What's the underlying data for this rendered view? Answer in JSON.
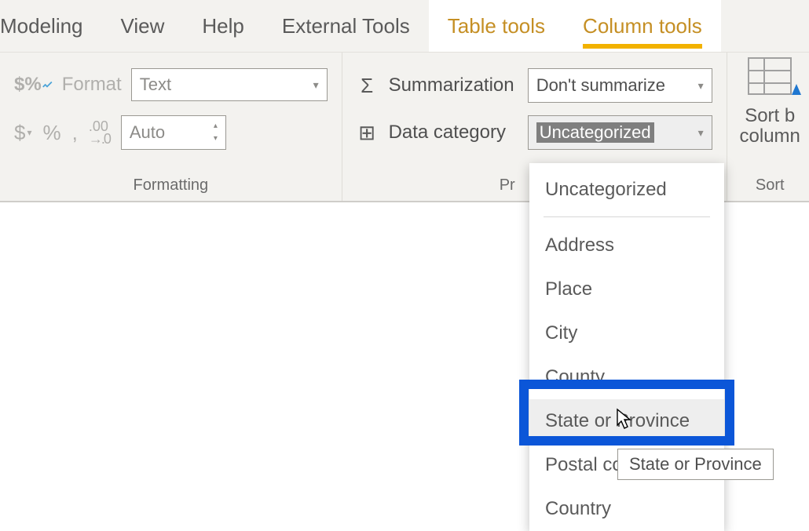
{
  "tabs": {
    "modeling": "Modeling",
    "view": "View",
    "help": "Help",
    "external_tools": "External Tools",
    "table_tools": "Table tools",
    "column_tools": "Column tools"
  },
  "formatting": {
    "format_label": "Format",
    "format_value": "Text",
    "auto_value": "Auto",
    "group_label": "Formatting"
  },
  "properties": {
    "summarization_label": "Summarization",
    "summarization_value": "Don't summarize",
    "data_category_label": "Data category",
    "data_category_value": "Uncategorized",
    "group_label_truncated": "Pr"
  },
  "sort": {
    "line1": "Sort b",
    "line2": "column",
    "group_label_truncated": "Sort"
  },
  "data_category_dropdown": {
    "items": [
      "Uncategorized",
      "Address",
      "Place",
      "City",
      "County",
      "State or Province",
      "Postal code",
      "Country"
    ],
    "hover_index": 5,
    "tooltip": "State or Province"
  },
  "icons": {
    "format": "$%",
    "currency": "$",
    "percent": "%",
    "thousands": ",",
    "decimals": ".00",
    "sigma": "Σ",
    "category": "⊞"
  }
}
